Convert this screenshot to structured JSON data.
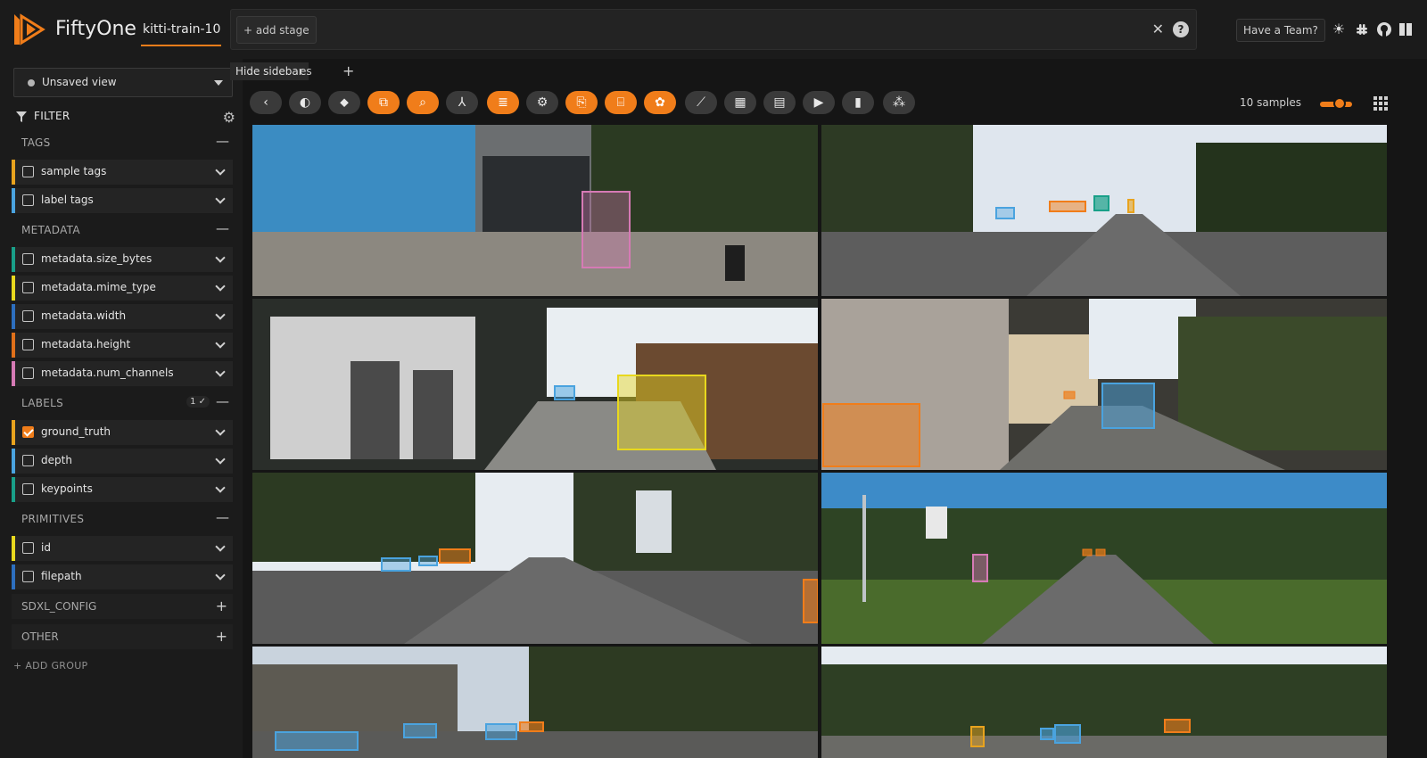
{
  "app": {
    "brand": "FiftyOne",
    "dataset": "kitti-train-10",
    "add_stage": "+ add stage",
    "team_button": "Have a Team?",
    "clear_icon": "close-icon",
    "help_icon": "help-icon"
  },
  "sidebar": {
    "view": "Unsaved view",
    "filter_label": "FILTER",
    "groups": {
      "tags": {
        "label": "TAGS",
        "ctrl": "—"
      },
      "metadata": {
        "label": "METADATA",
        "ctrl": "—"
      },
      "labels": {
        "label": "LABELS",
        "ctrl": "—",
        "badge": "1 ✓"
      },
      "primitives": {
        "label": "PRIMITIVES",
        "ctrl": "—"
      },
      "sdxl": {
        "label": "SDXL_CONFIG",
        "ctrl": "+"
      },
      "other": {
        "label": "OTHER",
        "ctrl": "+"
      }
    },
    "fields": {
      "sample_tags": {
        "label": "sample tags",
        "color": "#e8a31e"
      },
      "label_tags": {
        "label": "label tags",
        "color": "#4aa3df"
      },
      "size_bytes": {
        "label": "metadata.size_bytes",
        "color": "#19a089"
      },
      "mime_type": {
        "label": "metadata.mime_type",
        "color": "#e8d81e"
      },
      "width": {
        "label": "metadata.width",
        "color": "#2d6fbf"
      },
      "height": {
        "label": "metadata.height",
        "color": "#e0701a"
      },
      "num_channels": {
        "label": "metadata.num_channels",
        "color": "#d67ab5"
      },
      "ground_truth": {
        "label": "ground_truth",
        "color": "#e8a31e",
        "checked": true
      },
      "depth": {
        "label": "depth",
        "color": "#4aa3df"
      },
      "keypoints": {
        "label": "keypoints",
        "color": "#19a089"
      },
      "id": {
        "label": "id",
        "color": "#e8d81e"
      },
      "filepath": {
        "label": "filepath",
        "color": "#2d6fbf"
      }
    },
    "add_group": "+ ADD GROUP"
  },
  "tabs": {
    "tooltip": "Hide sidebar",
    "rest": "es",
    "plus": "+"
  },
  "toolbar": {
    "samples": "10 samples",
    "accent": "#f07d1a"
  }
}
